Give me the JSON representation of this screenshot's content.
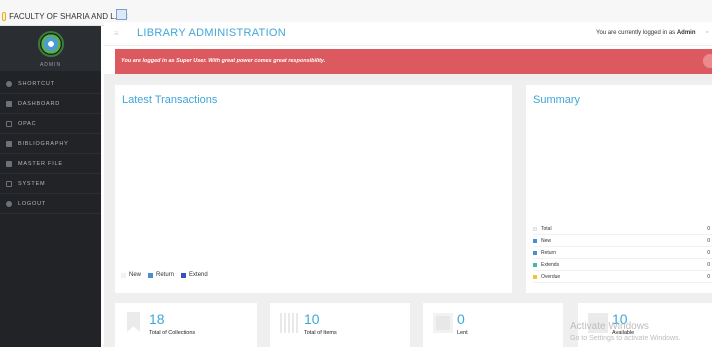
{
  "browser": {
    "tab_title": "FACULTY OF SHARIA AND L...",
    "tab_close": "×"
  },
  "sidebar": {
    "user_label": "ADMIN",
    "items": [
      {
        "label": "SHORTCUT",
        "icon": "star-icon"
      },
      {
        "label": "DASHBOARD",
        "icon": "dashboard-icon"
      },
      {
        "label": "OPAC",
        "icon": "monitor-icon"
      },
      {
        "label": "BIBLIOGRAPHY",
        "icon": "book-icon"
      },
      {
        "label": "MASTER FILE",
        "icon": "pencil-icon"
      },
      {
        "label": "SYSTEM",
        "icon": "keyboard-icon"
      },
      {
        "label": "LOGOUT",
        "icon": "power-icon"
      }
    ]
  },
  "header": {
    "menu_glyph": "≡",
    "title": "LIBRARY ADMINISTRATION",
    "login_prefix": "You are currently logged in as",
    "login_user": "Admin"
  },
  "alert": {
    "message": "You are logged in as Super User. With great power comes great responsibility."
  },
  "transactions": {
    "title": "Latest Transactions",
    "legend": [
      {
        "label": "New",
        "color": "#f2f2f2"
      },
      {
        "label": "Return",
        "color": "#4a8fcf"
      },
      {
        "label": "Extend",
        "color": "#3b4fc4"
      }
    ]
  },
  "summary": {
    "title": "Summary",
    "rows": [
      {
        "label": "Total",
        "value": "0",
        "color": "#f2f2f2"
      },
      {
        "label": "New",
        "value": "0",
        "color": "#4a8fcf"
      },
      {
        "label": "Return",
        "value": "0",
        "color": "#4a8fcf"
      },
      {
        "label": "Extends",
        "value": "0",
        "color": "#48b5a7"
      },
      {
        "label": "Overdue",
        "value": "0",
        "color": "#f2c230"
      }
    ]
  },
  "stats": [
    {
      "value": "18",
      "label": "Total of Collections",
      "icon": "bookmark-icon"
    },
    {
      "value": "10",
      "label": "Total of Items",
      "icon": "barcode-icon"
    },
    {
      "value": "0",
      "label": "Lent",
      "icon": "tray-icon"
    },
    {
      "value": "10",
      "label": "Available",
      "icon": "check-icon"
    }
  ],
  "watermark": {
    "title": "Activate Windows",
    "subtitle": "Go to Settings to activate Windows."
  },
  "colors": {
    "accent": "#3fa6d8",
    "sidebar_bg": "#212326",
    "alert_bg": "#dc5a5f"
  }
}
